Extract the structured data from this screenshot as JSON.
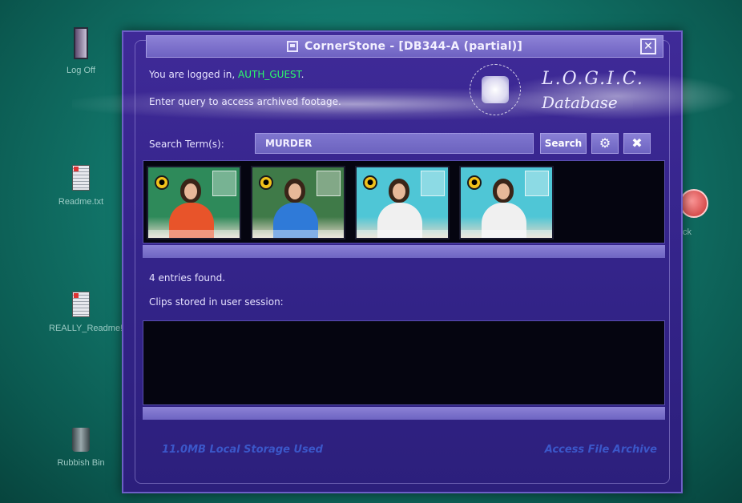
{
  "desktop": {
    "icons": [
      {
        "label": "Log Off",
        "icon": "door-icon"
      },
      {
        "label": "Readme.txt",
        "icon": "document-icon"
      },
      {
        "label": "REALLY_Readme!!.txt",
        "icon": "document-icon"
      },
      {
        "label": "Rubbish Bin",
        "icon": "bin-icon"
      }
    ],
    "right_icon_label": "ck"
  },
  "window": {
    "title": "CornerStone - [DB344-A (partial)]",
    "close_glyph": "✕"
  },
  "header": {
    "welcome_prefix": "You are logged in, ",
    "username": "AUTH_GUEST",
    "welcome_suffix": ".",
    "prompt": "Enter query to access archived footage.",
    "logo_title": "L.O.G.I.C.",
    "logo_subtitle": "Database"
  },
  "search": {
    "label": "Search Term(s):",
    "value": "MURDER",
    "button_label": "Search",
    "tool1_glyph": "⚙",
    "tool2_glyph": "✖"
  },
  "results": {
    "clips": [
      {
        "name": "clip-1",
        "bg": "#2e8a5a",
        "shirt": "#e8542a"
      },
      {
        "name": "clip-2",
        "bg": "#3f7a48",
        "shirt": "#2f7ad8"
      },
      {
        "name": "clip-3",
        "bg": "#4fc6d6",
        "shirt": "#f0f0f0"
      },
      {
        "name": "clip-4",
        "bg": "#4fc6d6",
        "shirt": "#f0f0f0"
      }
    ],
    "count_text": "4 entries found.",
    "clips_label": "Clips stored in user session:"
  },
  "footer": {
    "storage": "11.0MB Local Storage Used",
    "access": "Access File Archive"
  },
  "colors": {
    "window_bg": "#34248a",
    "username": "#2bff6a",
    "link": "#3b57c9",
    "desktop": "#12786c"
  }
}
